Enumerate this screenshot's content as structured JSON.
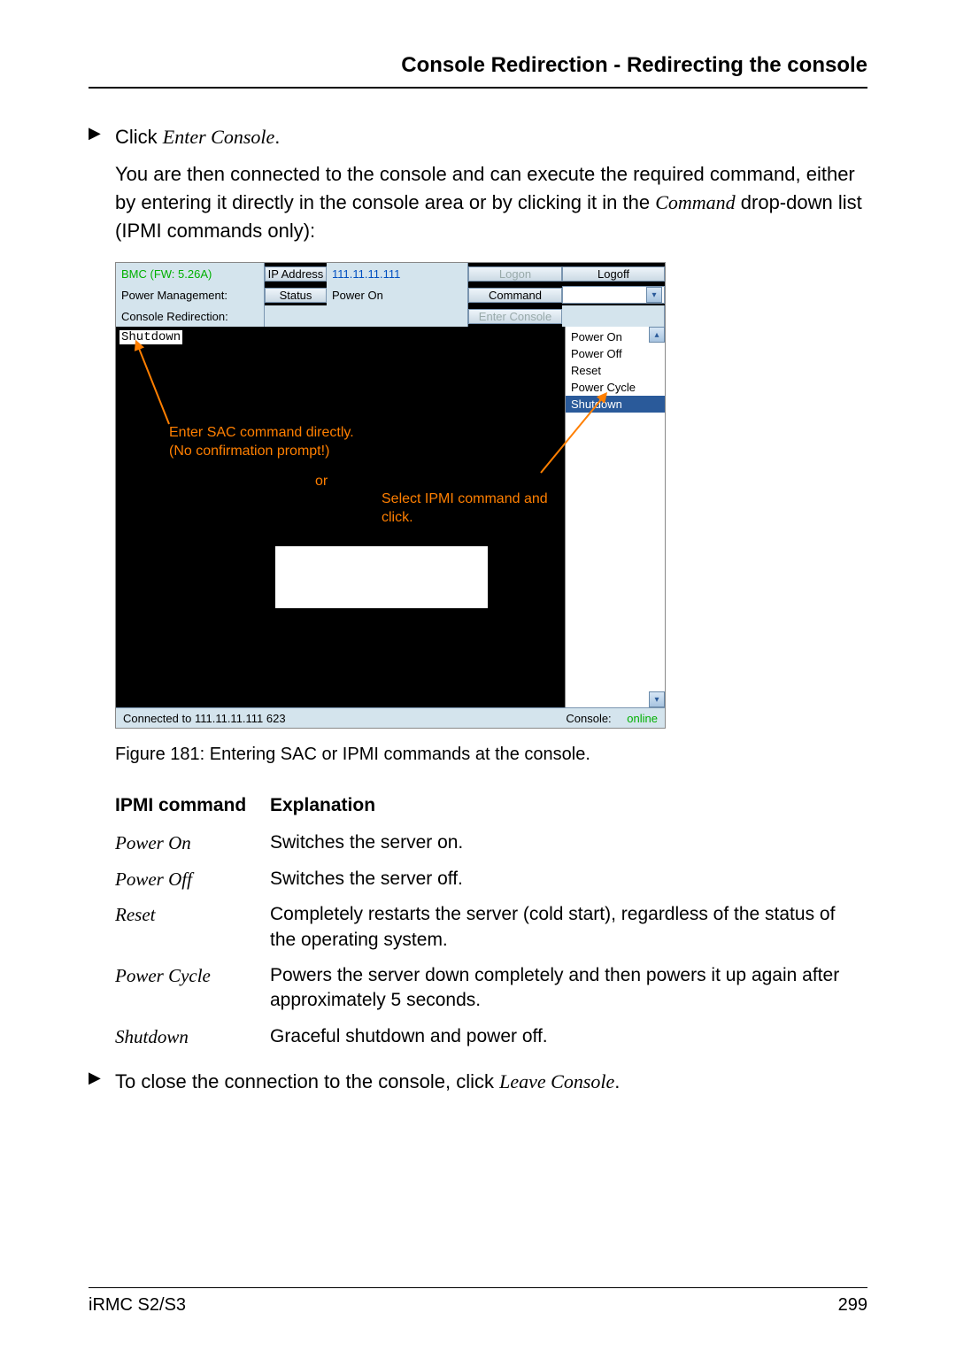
{
  "header": {
    "title": "Console Redirection - Redirecting the console"
  },
  "steps": {
    "click_prefix": "Click ",
    "click_action": "Enter Console",
    "click_suffix": ".",
    "connected_text_a": "You are then connected to the console and can execute the required command, either by entering it directly in the console area or by clicking it in the ",
    "connected_text_b": "Command",
    "connected_text_c": " drop-down list (IPMI commands only):",
    "close_prefix": "To close the connection to the console, click ",
    "close_action": "Leave Console",
    "close_suffix": "."
  },
  "screenshot": {
    "bmc_label": "BMC (FW: 5.26A)",
    "ip_label": "IP Address",
    "ip_value": "111.11.11.111",
    "logon": "Logon",
    "logoff": "Logoff",
    "pm_label": "Power Management:",
    "status_label": "Status",
    "status_value": "Power On",
    "command_label": "Command",
    "cr_label": "Console Redirection:",
    "enter_console": "Enter Console",
    "shutdown_text": "Shutdown",
    "dd_items": [
      "Power On",
      "Power Off",
      "Reset",
      "Power Cycle",
      "Shutdown"
    ],
    "annot1_l1": "Enter SAC command directly.",
    "annot1_l2": "(No confirmation prompt!)",
    "annot_or": "or",
    "annot2_l1": "Select IPMI command and",
    "annot2_l2": "click.",
    "status_conn": "Connected to 111.11.11.111 623",
    "status_console_label": "Console:",
    "status_console_val": "online"
  },
  "figure": {
    "caption": "Figure 181:  Entering SAC or IPMI commands at the console."
  },
  "table": {
    "h1": "IPMI command",
    "h2": "Explanation",
    "rows": [
      {
        "cmd": "Power On",
        "exp": "Switches the server on."
      },
      {
        "cmd": "Power Off",
        "exp": "Switches the server off."
      },
      {
        "cmd": "Reset",
        "exp": "Completely restarts the server (cold start), regardless of the status of the operating system."
      },
      {
        "cmd": "Power Cycle",
        "exp": "Powers the server down completely and then powers it up again after approximately 5 seconds."
      },
      {
        "cmd": "Shutdown",
        "exp": "Graceful shutdown and power off."
      }
    ]
  },
  "footer": {
    "left": "iRMC S2/S3",
    "right": "299"
  }
}
